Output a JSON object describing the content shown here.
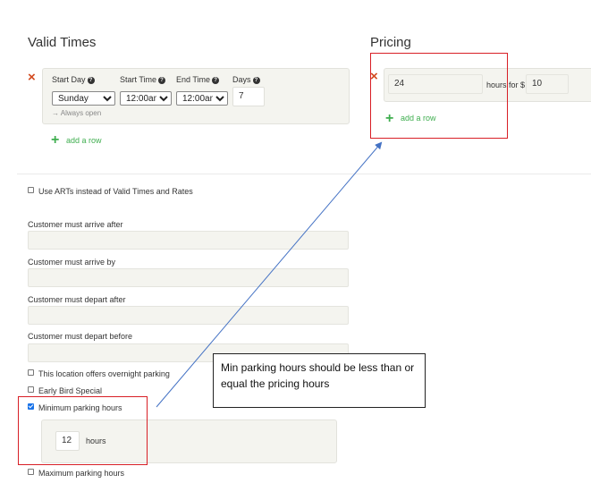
{
  "valid_times": {
    "title": "Valid Times",
    "col_start_day": "Start Day",
    "col_start_time": "Start Time",
    "col_end_time": "End Time",
    "col_days": "Days",
    "start_day_value": "Sunday",
    "start_time_value": "12:00am",
    "end_time_value": "12:00am",
    "days_value": "7",
    "always_open": "→ Always open",
    "add_row": "add a row"
  },
  "pricing": {
    "title": "Pricing",
    "hours_value": "24",
    "hours_for_label": "hours for $",
    "price_value": "10",
    "add_row": "add a row"
  },
  "options": {
    "use_arts_label": "Use ARTs instead of Valid Times and Rates",
    "arrive_after_label": "Customer must arrive after",
    "arrive_by_label": "Customer must arrive by",
    "depart_after_label": "Customer must depart after",
    "depart_before_label": "Customer must depart before",
    "overnight_label": "This location offers overnight parking",
    "early_bird_label": "Early Bird Special",
    "min_hours_label": "Minimum parking hours",
    "min_hours_value": "12",
    "min_hours_unit": "hours",
    "max_hours_label": "Maximum parking hours"
  },
  "annotation": {
    "callout_text": "Min parking hours should be less than or equal the pricing hours",
    "highlight_color": "#d81f26",
    "arrow_color": "#4472c4"
  },
  "icons": {
    "remove": "×",
    "add": "+",
    "help": "?"
  }
}
